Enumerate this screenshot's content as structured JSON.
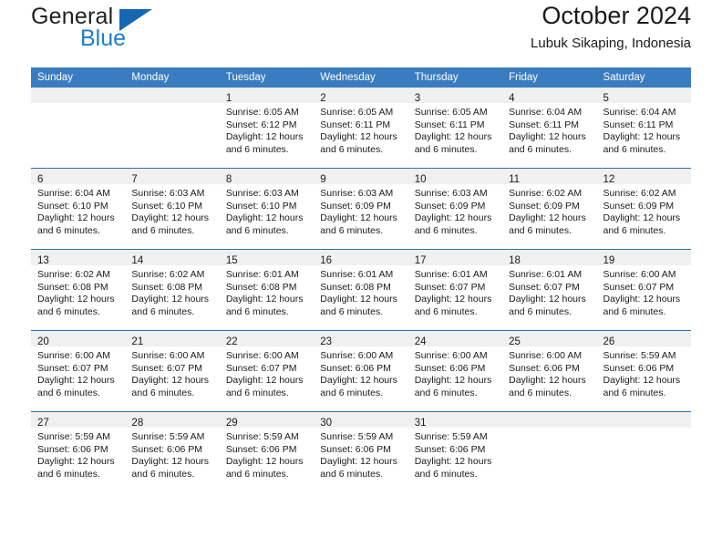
{
  "brand": {
    "name_top": "General",
    "name_bottom": "Blue",
    "triangle_color": "#1567b0",
    "blue_color": "#1f7ec4"
  },
  "header": {
    "title": "October 2024",
    "location": "Lubuk Sikaping, Indonesia"
  },
  "theme": {
    "header_bg": "#3a7cc0",
    "row_divider": "#2d6ead",
    "daynum_bg": "#f0f0f0"
  },
  "weekday_headers": [
    "Sunday",
    "Monday",
    "Tuesday",
    "Wednesday",
    "Thursday",
    "Friday",
    "Saturday"
  ],
  "labels": {
    "sunrise_prefix": "Sunrise:",
    "sunset_prefix": "Sunset:",
    "daylight_prefix": "Daylight:"
  },
  "weeks": [
    [
      {
        "day": "",
        "lines": []
      },
      {
        "day": "",
        "lines": []
      },
      {
        "day": "1",
        "lines": [
          "Sunrise: 6:05 AM",
          "Sunset: 6:12 PM",
          "Daylight: 12 hours",
          "and 6 minutes."
        ]
      },
      {
        "day": "2",
        "lines": [
          "Sunrise: 6:05 AM",
          "Sunset: 6:11 PM",
          "Daylight: 12 hours",
          "and 6 minutes."
        ]
      },
      {
        "day": "3",
        "lines": [
          "Sunrise: 6:05 AM",
          "Sunset: 6:11 PM",
          "Daylight: 12 hours",
          "and 6 minutes."
        ]
      },
      {
        "day": "4",
        "lines": [
          "Sunrise: 6:04 AM",
          "Sunset: 6:11 PM",
          "Daylight: 12 hours",
          "and 6 minutes."
        ]
      },
      {
        "day": "5",
        "lines": [
          "Sunrise: 6:04 AM",
          "Sunset: 6:11 PM",
          "Daylight: 12 hours",
          "and 6 minutes."
        ]
      }
    ],
    [
      {
        "day": "6",
        "lines": [
          "Sunrise: 6:04 AM",
          "Sunset: 6:10 PM",
          "Daylight: 12 hours",
          "and 6 minutes."
        ]
      },
      {
        "day": "7",
        "lines": [
          "Sunrise: 6:03 AM",
          "Sunset: 6:10 PM",
          "Daylight: 12 hours",
          "and 6 minutes."
        ]
      },
      {
        "day": "8",
        "lines": [
          "Sunrise: 6:03 AM",
          "Sunset: 6:10 PM",
          "Daylight: 12 hours",
          "and 6 minutes."
        ]
      },
      {
        "day": "9",
        "lines": [
          "Sunrise: 6:03 AM",
          "Sunset: 6:09 PM",
          "Daylight: 12 hours",
          "and 6 minutes."
        ]
      },
      {
        "day": "10",
        "lines": [
          "Sunrise: 6:03 AM",
          "Sunset: 6:09 PM",
          "Daylight: 12 hours",
          "and 6 minutes."
        ]
      },
      {
        "day": "11",
        "lines": [
          "Sunrise: 6:02 AM",
          "Sunset: 6:09 PM",
          "Daylight: 12 hours",
          "and 6 minutes."
        ]
      },
      {
        "day": "12",
        "lines": [
          "Sunrise: 6:02 AM",
          "Sunset: 6:09 PM",
          "Daylight: 12 hours",
          "and 6 minutes."
        ]
      }
    ],
    [
      {
        "day": "13",
        "lines": [
          "Sunrise: 6:02 AM",
          "Sunset: 6:08 PM",
          "Daylight: 12 hours",
          "and 6 minutes."
        ]
      },
      {
        "day": "14",
        "lines": [
          "Sunrise: 6:02 AM",
          "Sunset: 6:08 PM",
          "Daylight: 12 hours",
          "and 6 minutes."
        ]
      },
      {
        "day": "15",
        "lines": [
          "Sunrise: 6:01 AM",
          "Sunset: 6:08 PM",
          "Daylight: 12 hours",
          "and 6 minutes."
        ]
      },
      {
        "day": "16",
        "lines": [
          "Sunrise: 6:01 AM",
          "Sunset: 6:08 PM",
          "Daylight: 12 hours",
          "and 6 minutes."
        ]
      },
      {
        "day": "17",
        "lines": [
          "Sunrise: 6:01 AM",
          "Sunset: 6:07 PM",
          "Daylight: 12 hours",
          "and 6 minutes."
        ]
      },
      {
        "day": "18",
        "lines": [
          "Sunrise: 6:01 AM",
          "Sunset: 6:07 PM",
          "Daylight: 12 hours",
          "and 6 minutes."
        ]
      },
      {
        "day": "19",
        "lines": [
          "Sunrise: 6:00 AM",
          "Sunset: 6:07 PM",
          "Daylight: 12 hours",
          "and 6 minutes."
        ]
      }
    ],
    [
      {
        "day": "20",
        "lines": [
          "Sunrise: 6:00 AM",
          "Sunset: 6:07 PM",
          "Daylight: 12 hours",
          "and 6 minutes."
        ]
      },
      {
        "day": "21",
        "lines": [
          "Sunrise: 6:00 AM",
          "Sunset: 6:07 PM",
          "Daylight: 12 hours",
          "and 6 minutes."
        ]
      },
      {
        "day": "22",
        "lines": [
          "Sunrise: 6:00 AM",
          "Sunset: 6:07 PM",
          "Daylight: 12 hours",
          "and 6 minutes."
        ]
      },
      {
        "day": "23",
        "lines": [
          "Sunrise: 6:00 AM",
          "Sunset: 6:06 PM",
          "Daylight: 12 hours",
          "and 6 minutes."
        ]
      },
      {
        "day": "24",
        "lines": [
          "Sunrise: 6:00 AM",
          "Sunset: 6:06 PM",
          "Daylight: 12 hours",
          "and 6 minutes."
        ]
      },
      {
        "day": "25",
        "lines": [
          "Sunrise: 6:00 AM",
          "Sunset: 6:06 PM",
          "Daylight: 12 hours",
          "and 6 minutes."
        ]
      },
      {
        "day": "26",
        "lines": [
          "Sunrise: 5:59 AM",
          "Sunset: 6:06 PM",
          "Daylight: 12 hours",
          "and 6 minutes."
        ]
      }
    ],
    [
      {
        "day": "27",
        "lines": [
          "Sunrise: 5:59 AM",
          "Sunset: 6:06 PM",
          "Daylight: 12 hours",
          "and 6 minutes."
        ]
      },
      {
        "day": "28",
        "lines": [
          "Sunrise: 5:59 AM",
          "Sunset: 6:06 PM",
          "Daylight: 12 hours",
          "and 6 minutes."
        ]
      },
      {
        "day": "29",
        "lines": [
          "Sunrise: 5:59 AM",
          "Sunset: 6:06 PM",
          "Daylight: 12 hours",
          "and 6 minutes."
        ]
      },
      {
        "day": "30",
        "lines": [
          "Sunrise: 5:59 AM",
          "Sunset: 6:06 PM",
          "Daylight: 12 hours",
          "and 6 minutes."
        ]
      },
      {
        "day": "31",
        "lines": [
          "Sunrise: 5:59 AM",
          "Sunset: 6:06 PM",
          "Daylight: 12 hours",
          "and 6 minutes."
        ]
      },
      {
        "day": "",
        "lines": []
      },
      {
        "day": "",
        "lines": []
      }
    ]
  ]
}
